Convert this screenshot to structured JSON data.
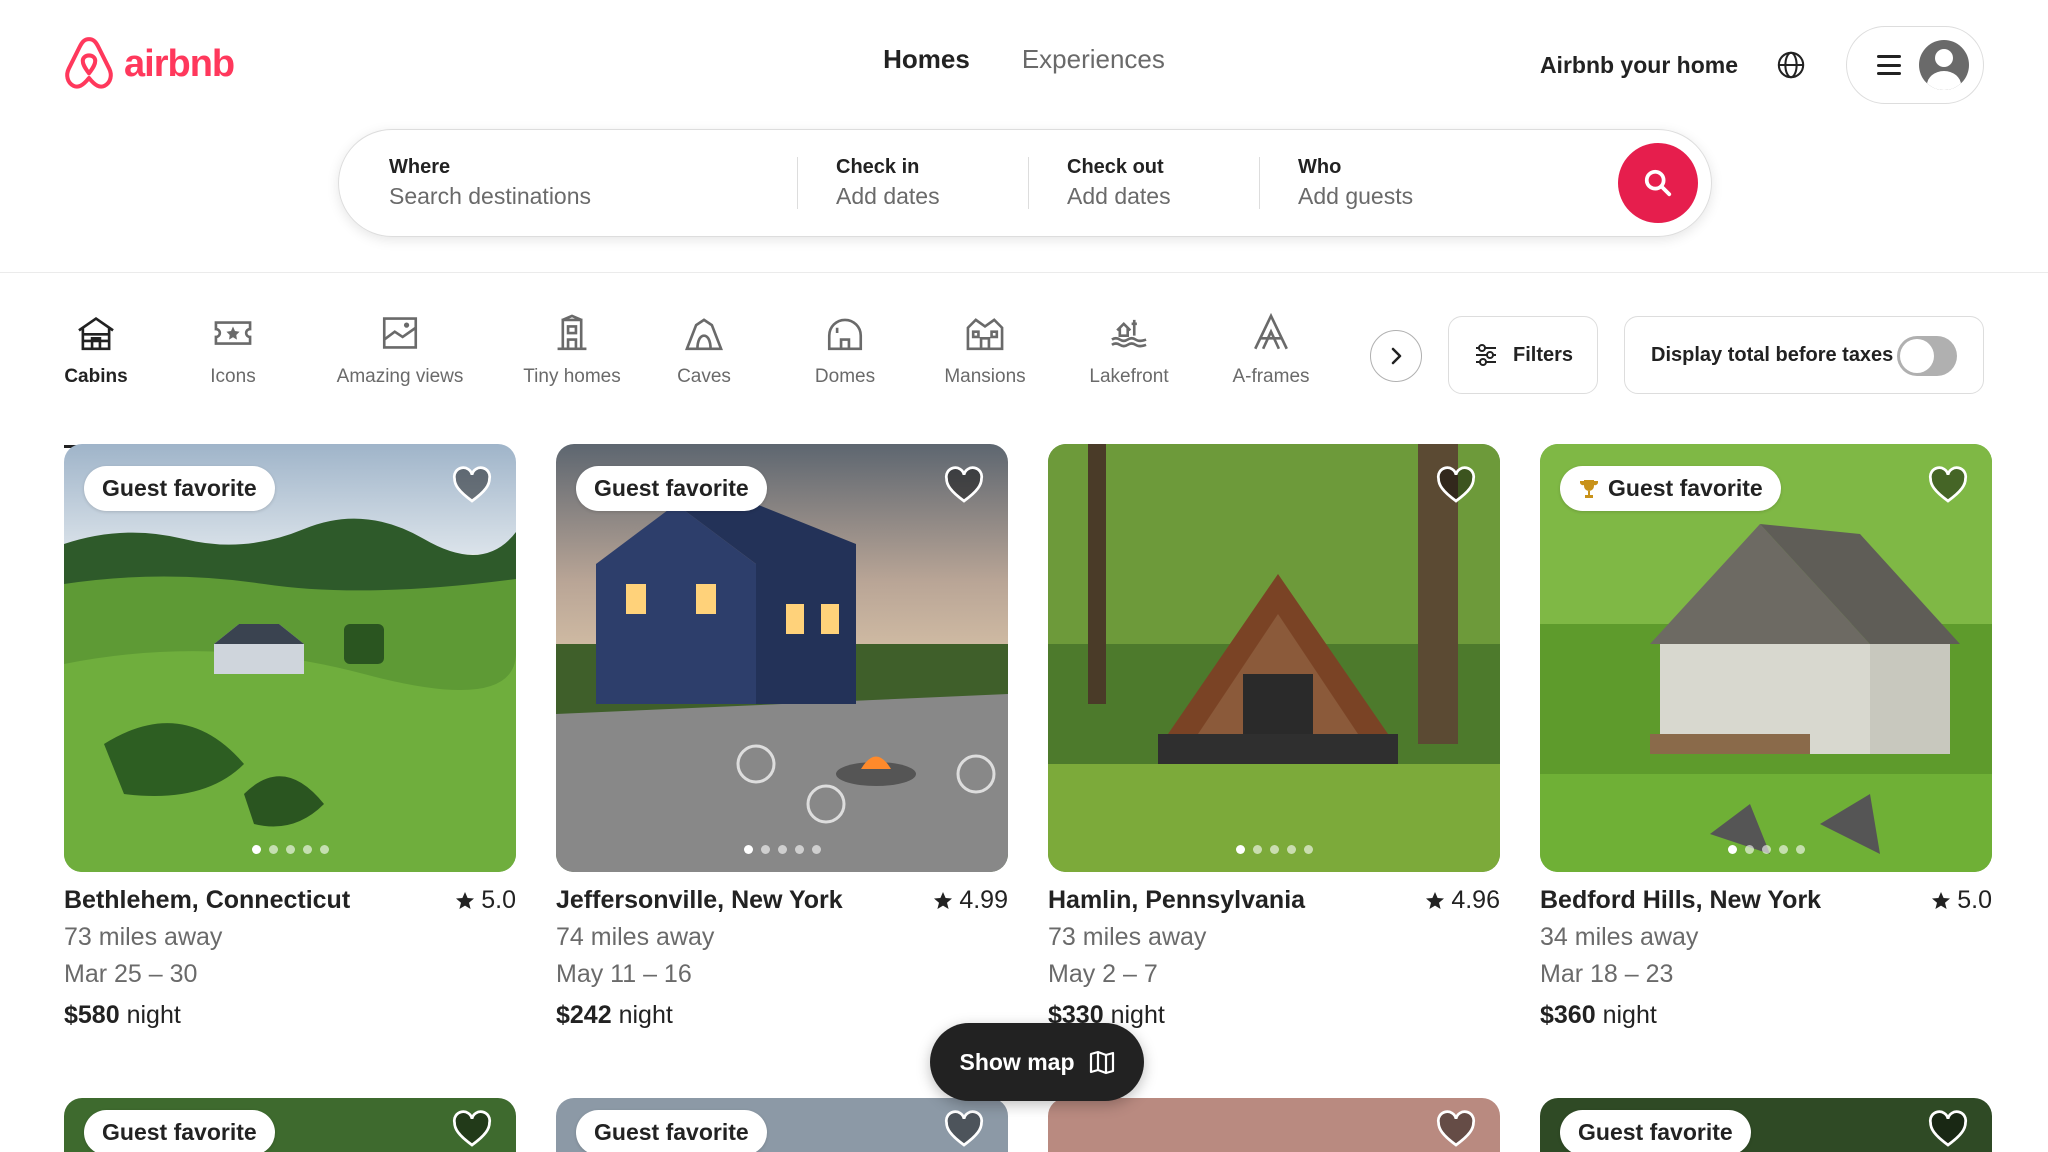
{
  "brand": {
    "name": "airbnb",
    "color": "#FF385C"
  },
  "nav": {
    "tabs": [
      {
        "label": "Homes",
        "active": true
      },
      {
        "label": "Experiences",
        "active": false
      }
    ]
  },
  "header": {
    "host_link": "Airbnb your home",
    "globe_icon": "globe-icon",
    "menu_icon": "hamburger-icon",
    "avatar_icon": "user-avatar"
  },
  "search": {
    "where": {
      "label": "Where",
      "placeholder": "Search destinations"
    },
    "check_in": {
      "label": "Check in",
      "placeholder": "Add dates"
    },
    "check_out": {
      "label": "Check out",
      "placeholder": "Add dates"
    },
    "who": {
      "label": "Who",
      "placeholder": "Add guests"
    },
    "button_color": "#E61E4D"
  },
  "categories": [
    {
      "label": "Cabins",
      "icon": "cabin-icon",
      "active": true
    },
    {
      "label": "Icons",
      "icon": "ticket-star-icon",
      "active": false
    },
    {
      "label": "Amazing views",
      "icon": "framed-view-icon",
      "active": false
    },
    {
      "label": "Tiny homes",
      "icon": "tiny-home-icon",
      "active": false
    },
    {
      "label": "Caves",
      "icon": "cave-icon",
      "active": false
    },
    {
      "label": "Domes",
      "icon": "dome-icon",
      "active": false
    },
    {
      "label": "Mansions",
      "icon": "mansion-icon",
      "active": false
    },
    {
      "label": "Lakefront",
      "icon": "lakefront-icon",
      "active": false
    },
    {
      "label": "A-frames",
      "icon": "a-frame-icon",
      "active": false
    }
  ],
  "filters": {
    "label": "Filters",
    "tax_toggle_label": "Display total before taxes",
    "tax_toggle_on": false
  },
  "listings": [
    {
      "badge": "Guest favorite",
      "trophy": false,
      "location": "Bethlehem, Connecticut",
      "rating": "5.0",
      "distance": "73 miles away",
      "dates": "Mar 25 – 30",
      "price": "$580",
      "price_unit": "night"
    },
    {
      "badge": "Guest favorite",
      "trophy": false,
      "location": "Jeffersonville, New York",
      "rating": "4.99",
      "distance": "74 miles away",
      "dates": "May 11 – 16",
      "price": "$242",
      "price_unit": "night"
    },
    {
      "badge": "",
      "trophy": false,
      "location": "Hamlin, Pennsylvania",
      "rating": "4.96",
      "distance": "73 miles away",
      "dates": "May 2 – 7",
      "price": "$330",
      "price_unit": "night"
    },
    {
      "badge": "Guest favorite",
      "trophy": true,
      "location": "Bedford Hills, New York",
      "rating": "5.0",
      "distance": "34 miles away",
      "dates": "Mar 18 – 23",
      "price": "$360",
      "price_unit": "night"
    }
  ],
  "next_row_badges": [
    "Guest favorite",
    "Guest favorite",
    "",
    "Guest favorite"
  ],
  "show_map": {
    "label": "Show map",
    "icon": "map-icon"
  }
}
